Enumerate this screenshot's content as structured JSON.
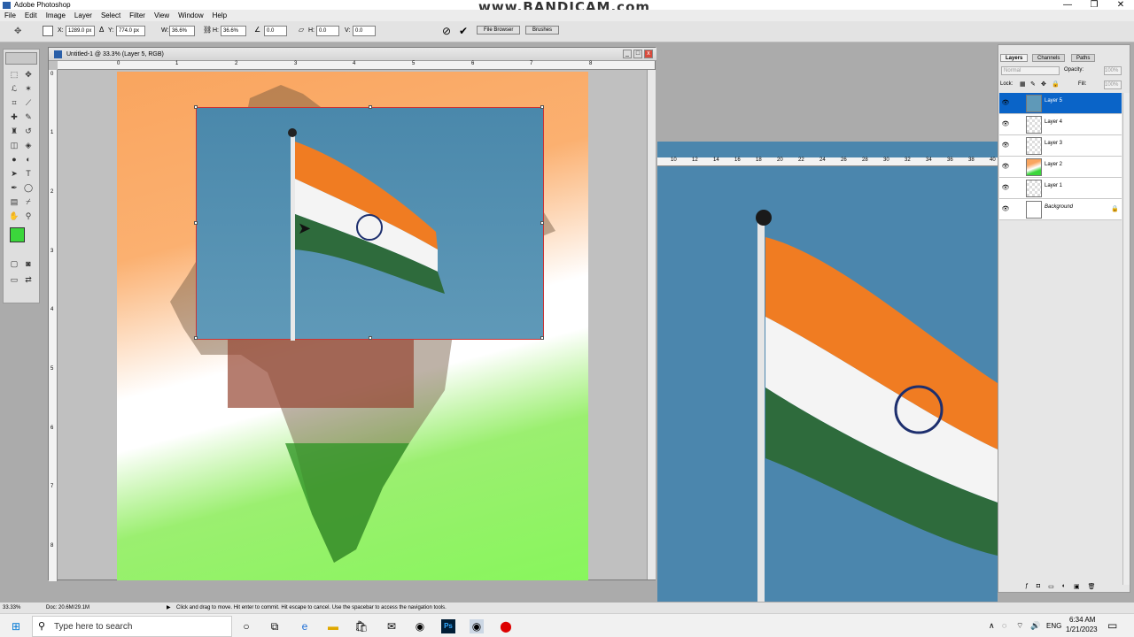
{
  "app": {
    "title": "Adobe Photoshop"
  },
  "watermark": "www.BANDICAM.com",
  "window_controls": {
    "minimize": "—",
    "restore": "❐",
    "close": "✕"
  },
  "menu": [
    "File",
    "Edit",
    "Image",
    "Layer",
    "Select",
    "Filter",
    "View",
    "Window",
    "Help"
  ],
  "options": {
    "x_label": "X:",
    "x_value": "1289.0 px",
    "y_label": "Y:",
    "y_value": "774.0 px",
    "w_label": "W:",
    "w_value": "36.6%",
    "h_label": "H:",
    "h_value": "36.6%",
    "rotate_value": "0.0",
    "hskew_label": "H:",
    "hskew_value": "0.0",
    "vskew_label": "V:",
    "vskew_value": "0.0",
    "cancel_icon": "cancel-transform-icon",
    "commit_icon": "commit-transform-icon",
    "file_browser_tab": "File Browser",
    "brushes_tab": "Brushes"
  },
  "document": {
    "title": "Untitled-1 @ 33.3% (Layer 5, RGB)",
    "ruler_h_ticks": [
      "0",
      "1",
      "2",
      "3",
      "4",
      "5",
      "6",
      "7",
      "8"
    ],
    "ruler_v_ticks": [
      "0",
      "1",
      "2",
      "3",
      "4",
      "5",
      "6",
      "7",
      "8"
    ]
  },
  "second_doc": {
    "ruler_ticks": [
      "10",
      "12",
      "14",
      "16",
      "18",
      "20",
      "22",
      "24",
      "26",
      "28",
      "30",
      "32",
      "34",
      "36",
      "38",
      "40"
    ]
  },
  "layers_panel": {
    "tabs": [
      "Layers",
      "Channels",
      "Paths"
    ],
    "blend_mode": "Normal",
    "opacity_label": "Opacity:",
    "opacity_value": "100%",
    "lock_label": "Lock:",
    "fill_label": "Fill:",
    "fill_value": "100%",
    "layers": [
      {
        "name": "Layer 5",
        "selected": true
      },
      {
        "name": "Layer 4",
        "selected": false
      },
      {
        "name": "Layer 3",
        "selected": false
      },
      {
        "name": "Layer 2",
        "selected": false
      },
      {
        "name": "Layer 1",
        "selected": false
      },
      {
        "name": "Background",
        "selected": false
      }
    ]
  },
  "status": {
    "zoom": "33.33%",
    "doc_info": "Doc: 20.6M/29.1M",
    "hint": "Click and drag to move. Hit enter to commit. Hit escape to cancel. Use the spacebar to access the navigation tools."
  },
  "taskbar": {
    "search_placeholder": "Type here to search",
    "language": "ENG",
    "time": "6:34 AM",
    "date": "1/21/2023"
  },
  "colors": {
    "foreground": "#3bd63b",
    "background": "#ffffff",
    "selection": "#0a64c8"
  }
}
